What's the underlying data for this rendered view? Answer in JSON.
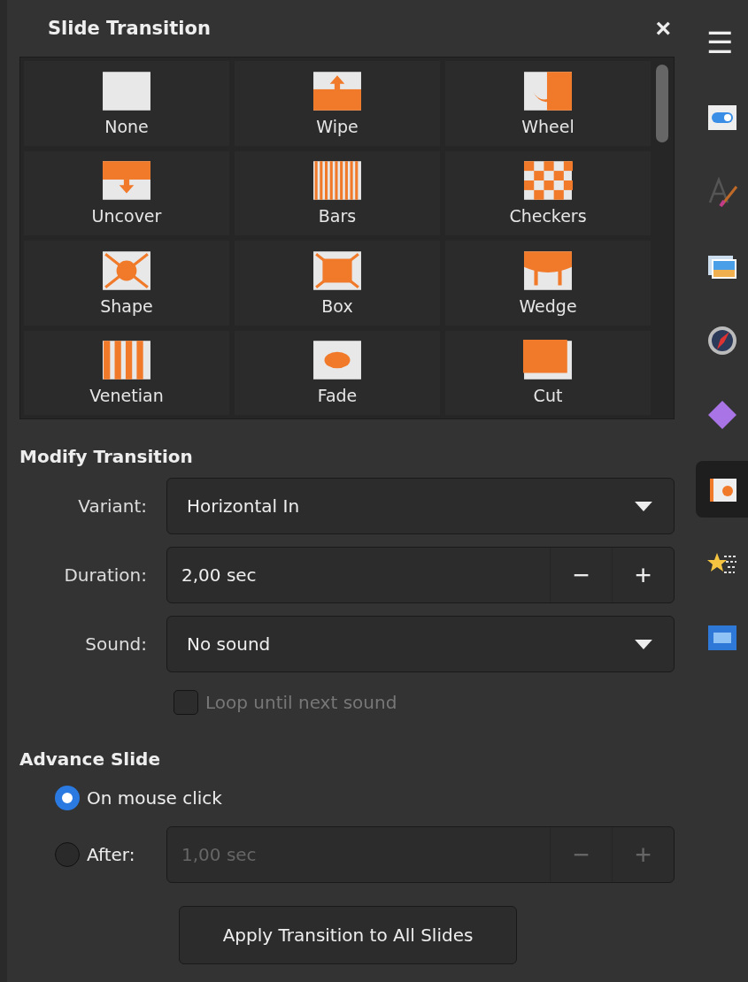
{
  "panel": {
    "title": "Slide Transition",
    "close": "×"
  },
  "transitions": [
    {
      "label": "None",
      "selected": false
    },
    {
      "label": "Wipe",
      "selected": false
    },
    {
      "label": "Wheel",
      "selected": false
    },
    {
      "label": "Uncover",
      "selected": false
    },
    {
      "label": "Bars",
      "selected": false
    },
    {
      "label": "Checkers",
      "selected": false
    },
    {
      "label": "Shape",
      "selected": false
    },
    {
      "label": "Box",
      "selected": false
    },
    {
      "label": "Wedge",
      "selected": false
    },
    {
      "label": "Venetian",
      "selected": false
    },
    {
      "label": "Fade",
      "selected": false
    },
    {
      "label": "Cut",
      "selected": false
    }
  ],
  "modify": {
    "heading": "Modify Transition",
    "rows": [
      {
        "kind": "dropdown",
        "label": "Variant:",
        "value": "Horizontal In"
      },
      {
        "kind": "spin",
        "label": "Duration:",
        "value": "2,00 sec",
        "minus": "−",
        "plus": "+"
      },
      {
        "kind": "dropdown",
        "label": "Sound:",
        "value": "No sound"
      }
    ],
    "loop": {
      "label": "Loop until next sound",
      "checked": false,
      "disabled": true
    }
  },
  "advance": {
    "heading": "Advance Slide",
    "options": [
      {
        "label": "On mouse click",
        "selected": true
      },
      {
        "label": "After:",
        "selected": false,
        "spin": {
          "value": "1,00 sec",
          "minus": "−",
          "plus": "+",
          "disabled": true
        }
      }
    ]
  },
  "apply_button": "Apply Transition to All Slides",
  "sidebar": {
    "menu": "☰",
    "items": [
      {
        "selected": false
      },
      {
        "selected": false
      },
      {
        "selected": false
      },
      {
        "selected": false
      },
      {
        "selected": false
      },
      {
        "selected": true
      },
      {
        "selected": false
      },
      {
        "selected": false
      }
    ]
  }
}
